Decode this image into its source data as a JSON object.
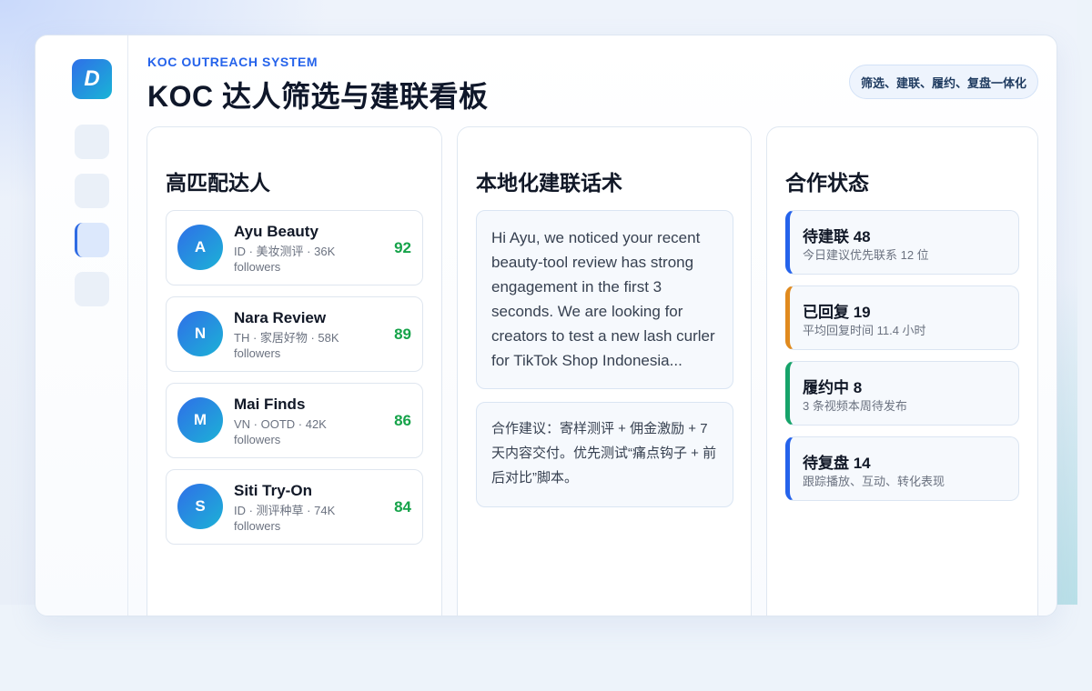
{
  "header": {
    "kicker": "KOC OUTREACH SYSTEM",
    "title": "KOC 达人筛选与建联看板",
    "pill": "筛选、建联、履约、复盘一体化",
    "logo_letter": "D"
  },
  "panels": {
    "creators": {
      "title": "高匹配达人",
      "items": [
        {
          "initial": "A",
          "name": "Ayu Beauty",
          "meta": "ID · 美妆测评 · 36K followers",
          "score": "92"
        },
        {
          "initial": "N",
          "name": "Nara Review",
          "meta": "TH · 家居好物 · 58K followers",
          "score": "89"
        },
        {
          "initial": "M",
          "name": "Mai Finds",
          "meta": "VN · OOTD · 42K followers",
          "score": "86"
        },
        {
          "initial": "S",
          "name": "Siti Try-On",
          "meta": "ID · 测评种草 · 74K followers",
          "score": "84"
        }
      ]
    },
    "outreach": {
      "title": "本地化建联话术",
      "message": "Hi Ayu, we noticed your recent beauty-tool review has strong engagement in the first 3 seconds. We are looking for creators to test a new lash curler for TikTok Shop Indonesia...",
      "suggestion": "合作建议：寄样测评 + 佣金激励 + 7 天内容交付。优先测试“痛点钩子 + 前后对比”脚本。"
    },
    "status": {
      "title": "合作状态",
      "items": [
        {
          "title": "待建联 48",
          "sub": "今日建议优先联系 12 位",
          "color": "#2563eb"
        },
        {
          "title": "已回复 19",
          "sub": "平均回复时间 11.4 小时",
          "color": "#e08a1e"
        },
        {
          "title": "履约中 8",
          "sub": "3 条视频本周待发布",
          "color": "#16a36a"
        },
        {
          "title": "待复盘 14",
          "sub": "跟踪播放、互动、转化表现",
          "color": "#2563eb"
        }
      ]
    }
  },
  "colors": {
    "accent": "#2563eb",
    "score": "#16a34a"
  }
}
